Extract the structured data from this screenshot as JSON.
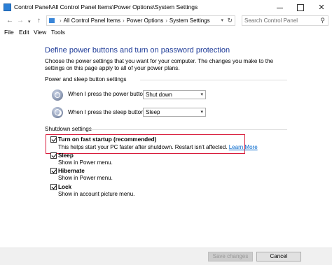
{
  "window": {
    "title": "Control Panel\\All Control Panel Items\\Power Options\\System Settings",
    "icon": "control-panel-icon"
  },
  "address": {
    "crumbs": [
      "All Control Panel Items",
      "Power Options",
      "System Settings"
    ],
    "search_placeholder": "Search Control Panel"
  },
  "menu": [
    "File",
    "Edit",
    "View",
    "Tools"
  ],
  "page": {
    "heading": "Define power buttons and turn on password protection",
    "description": "Choose the power settings that you want for your computer. The changes you make to the settings on this page apply to all of your power plans."
  },
  "power_group": {
    "label": "Power and sleep button settings",
    "power_button": {
      "label": "When I press the power button:",
      "value": "Shut down"
    },
    "sleep_button": {
      "label": "When I press the sleep button:",
      "value": "Sleep"
    }
  },
  "shutdown_group": {
    "label": "Shutdown settings",
    "options": [
      {
        "title": "Turn on fast startup (recommended)",
        "desc": "This helps start your PC faster after shutdown. Restart isn't affected.",
        "link": "Learn More",
        "checked": true
      },
      {
        "title": "Sleep",
        "desc": "Show in Power menu.",
        "checked": true
      },
      {
        "title": "Hibernate",
        "desc": "Show in Power menu.",
        "checked": true
      },
      {
        "title": "Lock",
        "desc": "Show in account picture menu.",
        "checked": true
      }
    ]
  },
  "footer": {
    "save_label": "Save changes",
    "cancel_label": "Cancel"
  },
  "colors": {
    "heading": "#1e3b98",
    "highlight_border": "#d81b3a",
    "link": "#0066cc"
  }
}
